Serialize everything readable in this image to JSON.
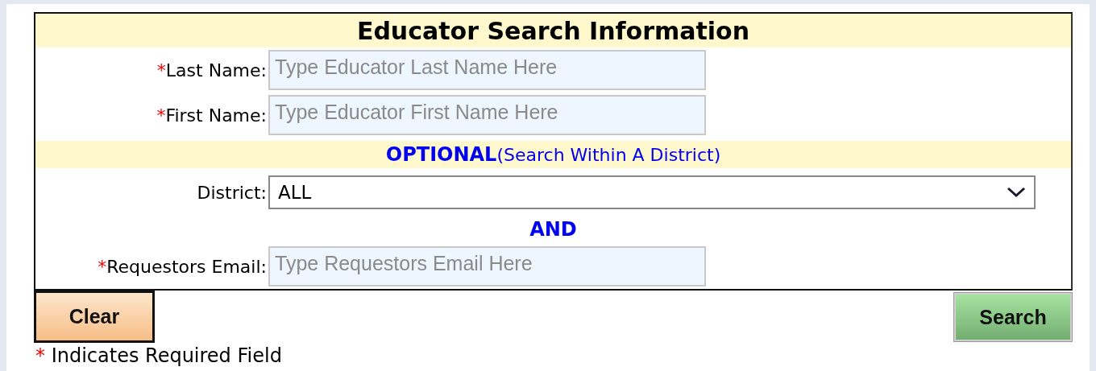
{
  "form": {
    "title": "Educator Search Information",
    "rows": [
      {
        "kind": "input",
        "marker": "*",
        "label": "Last Name:",
        "placeholder": "Type Educator Last Name Here"
      },
      {
        "kind": "input",
        "marker": "*",
        "label": "First Name:",
        "placeholder": "Type Educator First Name Here"
      },
      {
        "kind": "band",
        "text": "**OPTIONAL**(Search Within A District)"
      },
      {
        "kind": "select",
        "label": "District:",
        "value": "ALL"
      },
      {
        "kind": "connector",
        "text": "AND"
      },
      {
        "kind": "input",
        "marker": "*",
        "label": "Requestors Email:",
        "placeholder": "Type Requestors Email Here"
      }
    ]
  },
  "buttons": [
    {
      "kind": "clear",
      "label": "Clear"
    },
    {
      "kind": "search",
      "label": "Search"
    }
  ],
  "footnote": {
    "marker": "*",
    "text": "Indicates Required Field"
  }
}
